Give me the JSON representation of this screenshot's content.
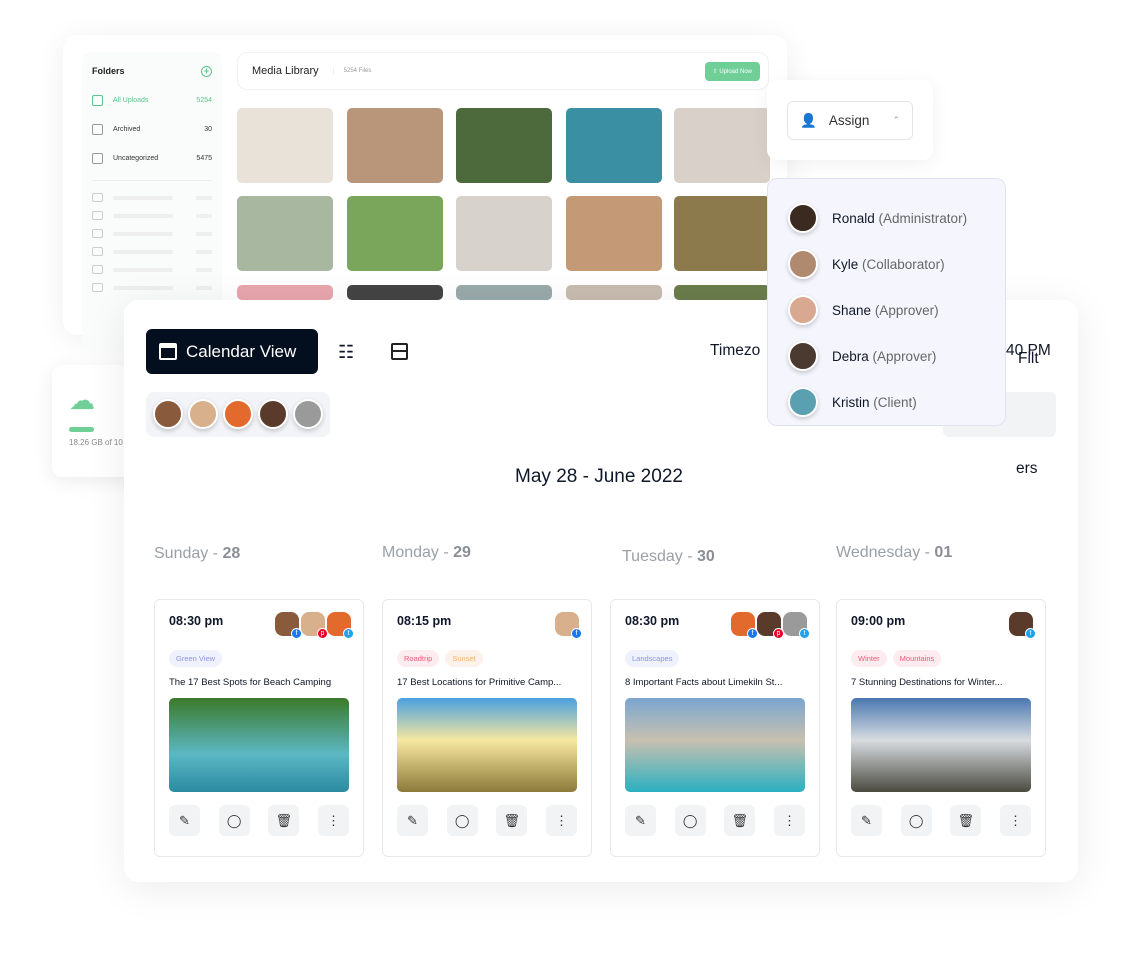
{
  "media": {
    "title": "Media Library",
    "files": "5254 Files",
    "upload": "Upload Now",
    "folders_title": "Folders",
    "folders": [
      {
        "label": "All Uploads",
        "count": "5254"
      },
      {
        "label": "Archived",
        "count": "30"
      },
      {
        "label": "Uncategorized",
        "count": "5475"
      }
    ]
  },
  "storage": {
    "text": "18.26 GB of 10",
    "fraction": 0.18
  },
  "calendar": {
    "view_label": "Calendar View",
    "timezone_partial": "Timezo",
    "time_partial": "40 PM",
    "filter_partial": "Filt",
    "filters_partial": "ers",
    "range": "May 28 - June 2022",
    "days": [
      {
        "name": "Sunday - ",
        "num": "28"
      },
      {
        "name": "Monday - ",
        "num": "29"
      },
      {
        "name": "Tuesday - ",
        "num": "30"
      },
      {
        "name": "Wednesday - ",
        "num": "01"
      }
    ],
    "posts": [
      {
        "time": "08:30 pm",
        "tags": [
          {
            "label": "Green View",
            "kind": "blue"
          }
        ],
        "title": "The 17 Best Spots for Beach Camping",
        "networks": [
          "facebook",
          "pinterest",
          "twitter"
        ]
      },
      {
        "time": "08:15 pm",
        "tags": [
          {
            "label": "Roadtrip",
            "kind": "pink"
          },
          {
            "label": "Sunset",
            "kind": "orange"
          }
        ],
        "title": "17 Best Locations for Primitive Camp...",
        "networks": [
          "facebook"
        ]
      },
      {
        "time": "08:30 pm",
        "tags": [
          {
            "label": "Landscapes",
            "kind": "blue"
          }
        ],
        "title": "8 Important Facts about Limekiln St...",
        "networks": [
          "facebook",
          "pinterest",
          "twitter"
        ]
      },
      {
        "time": "09:00 pm",
        "tags": [
          {
            "label": "Winter",
            "kind": "pink"
          },
          {
            "label": "Mountains",
            "kind": "pink"
          }
        ],
        "title": "7 Stunning Destinations for Winter...",
        "networks": [
          "twitter"
        ]
      }
    ]
  },
  "assign": {
    "label": "Assign",
    "users": [
      {
        "name": "Ronald",
        "role": "(Administrator)"
      },
      {
        "name": "Kyle",
        "role": "(Collaborator)"
      },
      {
        "name": "Shane",
        "role": "(Approver)"
      },
      {
        "name": "Debra",
        "role": "(Approver)"
      },
      {
        "name": "Kristin",
        "role": "(Client)"
      }
    ]
  },
  "colors": {
    "accent_green": "#5cc48a",
    "dark": "#030e1f",
    "facebook": "#1877f2",
    "pinterest": "#e60023",
    "twitter": "#1da1f2"
  }
}
